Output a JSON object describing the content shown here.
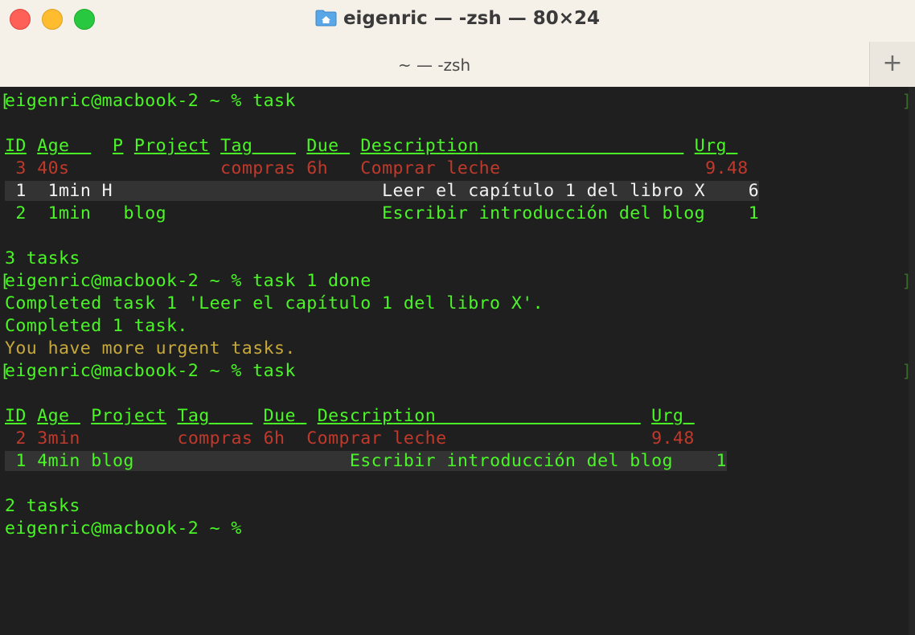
{
  "window": {
    "title": "eigenric — -zsh — 80×24",
    "tab": "~ — -zsh",
    "plus": "+"
  },
  "terminal": {
    "prompt1": "eigenric@macbook-2 ~ % task",
    "t1": {
      "header": {
        "id": "ID",
        "age": "Age",
        "p": "P",
        "project": "Project",
        "tag": "Tag",
        "due": "Due",
        "desc": "Description",
        "urg": "Urg"
      },
      "rows": [
        {
          "id": "3",
          "age": "40s",
          "p": "",
          "project": "",
          "tag": "compras",
          "due": "6h",
          "desc": "Comprar leche",
          "urg": "9.48"
        },
        {
          "id": "1",
          "age": "1min",
          "p": "H",
          "project": "",
          "tag": "",
          "due": "",
          "desc": "Leer el capítulo 1 del libro X",
          "urg": "6"
        },
        {
          "id": "2",
          "age": "1min",
          "p": "",
          "project": "blog",
          "tag": "",
          "due": "",
          "desc": "Escribir introducción del blog",
          "urg": "1"
        }
      ],
      "count": "3 tasks"
    },
    "prompt2": "eigenric@macbook-2 ~ % task 1 done",
    "out1": "Completed task 1 'Leer el capítulo 1 del libro X'.",
    "out2": "Completed 1 task.",
    "out3": "You have more urgent tasks.",
    "prompt3": "eigenric@macbook-2 ~ % task",
    "t2": {
      "header": {
        "id": "ID",
        "age": "Age",
        "project": "Project",
        "tag": "Tag",
        "due": "Due",
        "desc": "Description",
        "urg": "Urg"
      },
      "rows": [
        {
          "id": "2",
          "age": "3min",
          "project": "",
          "tag": "compras",
          "due": "6h",
          "desc": "Comprar leche",
          "urg": "9.48"
        },
        {
          "id": "1",
          "age": "4min",
          "project": "blog",
          "tag": "",
          "due": "",
          "desc": "Escribir introducción del blog",
          "urg": "1"
        }
      ],
      "count": "2 tasks"
    },
    "prompt4": "eigenric@macbook-2 ~ % "
  },
  "colors": {
    "green": "#4af626",
    "red": "#c0392b",
    "white": "#f2f2f2",
    "yellow": "#c7a83a",
    "background": "#1f1f1f"
  }
}
